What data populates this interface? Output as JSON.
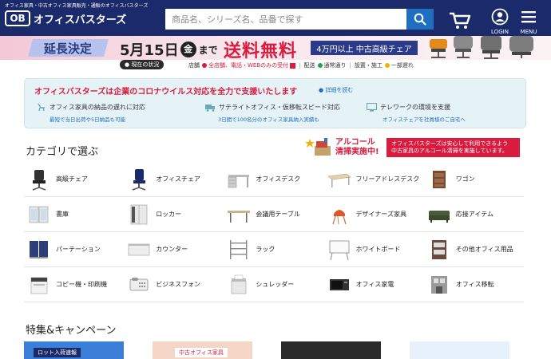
{
  "header": {
    "tagline": "オフィス家具・中古オフィス家具販売・通販のオフィスバスターズ",
    "logo_mark": "OB",
    "logo_text": "オフィスバスターズ",
    "search_placeholder": "商品名、シリーズ名、品番で探す",
    "login_label": "LOGIN",
    "menu_label": "MENU"
  },
  "banner": {
    "extension": "延長決定",
    "date_month_day": "5月15日",
    "date_weekday": "金",
    "date_suffix": "まで",
    "free_shipping": "送料無料",
    "condition": "4万円以上 中古高級チェア"
  },
  "status": {
    "now_label": "現在の状況",
    "store_label": "店舗",
    "store_text": "全店舗、電話・WEBのみの受付",
    "delivery_label": "配送",
    "delivery_text": "通常通り",
    "install_label": "設置・施工",
    "install_text": "一部遅れ"
  },
  "notice": {
    "title": "オフィスバスターズは企業のコロナウイルス対応を全力で支援いたします",
    "detail_link": "詳細を読む",
    "columns": [
      {
        "head": "オフィス家具の納品の遅れに対応",
        "sub": "最短で当日出荷や5日納品も可能"
      },
      {
        "head": "サテライトオフィス・仮移転スピード対応",
        "sub": "3日間で100名分のオフィス家具納入実績も"
      },
      {
        "head": "テレワークの環境を支援",
        "sub": "オフィスチェアを社員様のご自宅へ"
      }
    ]
  },
  "categories": {
    "title": "カテゴリで選ぶ",
    "alcohol_text_line1": "アルコール",
    "alcohol_text_line2": "清掃実施中!",
    "alcohol_notice_line1": "オフィスバスターズは安心して利用できるよう",
    "alcohol_notice_line2": "中古家具のアルコール清掃を実施しています。",
    "items": [
      {
        "label": "高級チェア"
      },
      {
        "label": "オフィスチェア"
      },
      {
        "label": "オフィスデスク"
      },
      {
        "label": "フリーアドレスデスク"
      },
      {
        "label": "ワゴン"
      },
      {
        "label": "書庫"
      },
      {
        "label": "ロッカー"
      },
      {
        "label": "会議用テーブル"
      },
      {
        "label": "デザイナーズ家具"
      },
      {
        "label": "応接アイテム"
      },
      {
        "label": "パーテーション"
      },
      {
        "label": "カウンター"
      },
      {
        "label": "ラック"
      },
      {
        "label": "ホワイトボード"
      },
      {
        "label": "その他オフィス用品"
      },
      {
        "label": "コピー機・印刷機"
      },
      {
        "label": "ビジネスフォン"
      },
      {
        "label": "シュレッダー"
      },
      {
        "label": "オフィス家電"
      },
      {
        "label": "オフィス移転"
      }
    ]
  },
  "features": {
    "title": "特集&キャンペーン",
    "card1_text": "ロット入荷速報",
    "card2_text": "中古オフィス家具"
  },
  "colors": {
    "navy": "#1b2a6b",
    "accent_red": "#d81b3f",
    "accent_blue": "#1f6fc0"
  }
}
